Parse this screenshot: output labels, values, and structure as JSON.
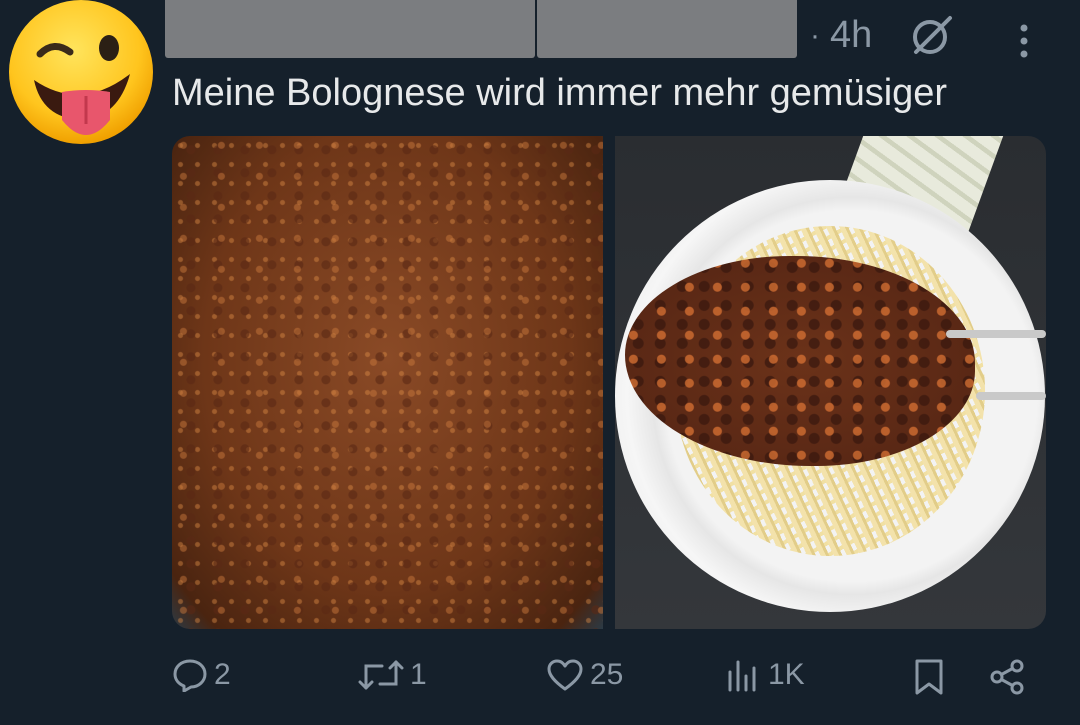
{
  "tweet": {
    "time": "4h",
    "dot": "·",
    "text": "Meine Bolognese wird immer mehr gemüsiger"
  },
  "actions": {
    "replies": "2",
    "retweets": "1",
    "likes": "25",
    "views": "1K"
  },
  "icons": {
    "avatar": "winking-tongue-emoji-icon",
    "grok": "grok-icon",
    "more": "more-vertical-icon",
    "reply": "reply-icon",
    "retweet": "retweet-icon",
    "like": "heart-icon",
    "views": "views-icon",
    "bookmark": "bookmark-icon",
    "share": "share-icon"
  },
  "colors": {
    "background": "#15202b",
    "text": "#e7e9ea",
    "secondary": "#8b98a5"
  }
}
